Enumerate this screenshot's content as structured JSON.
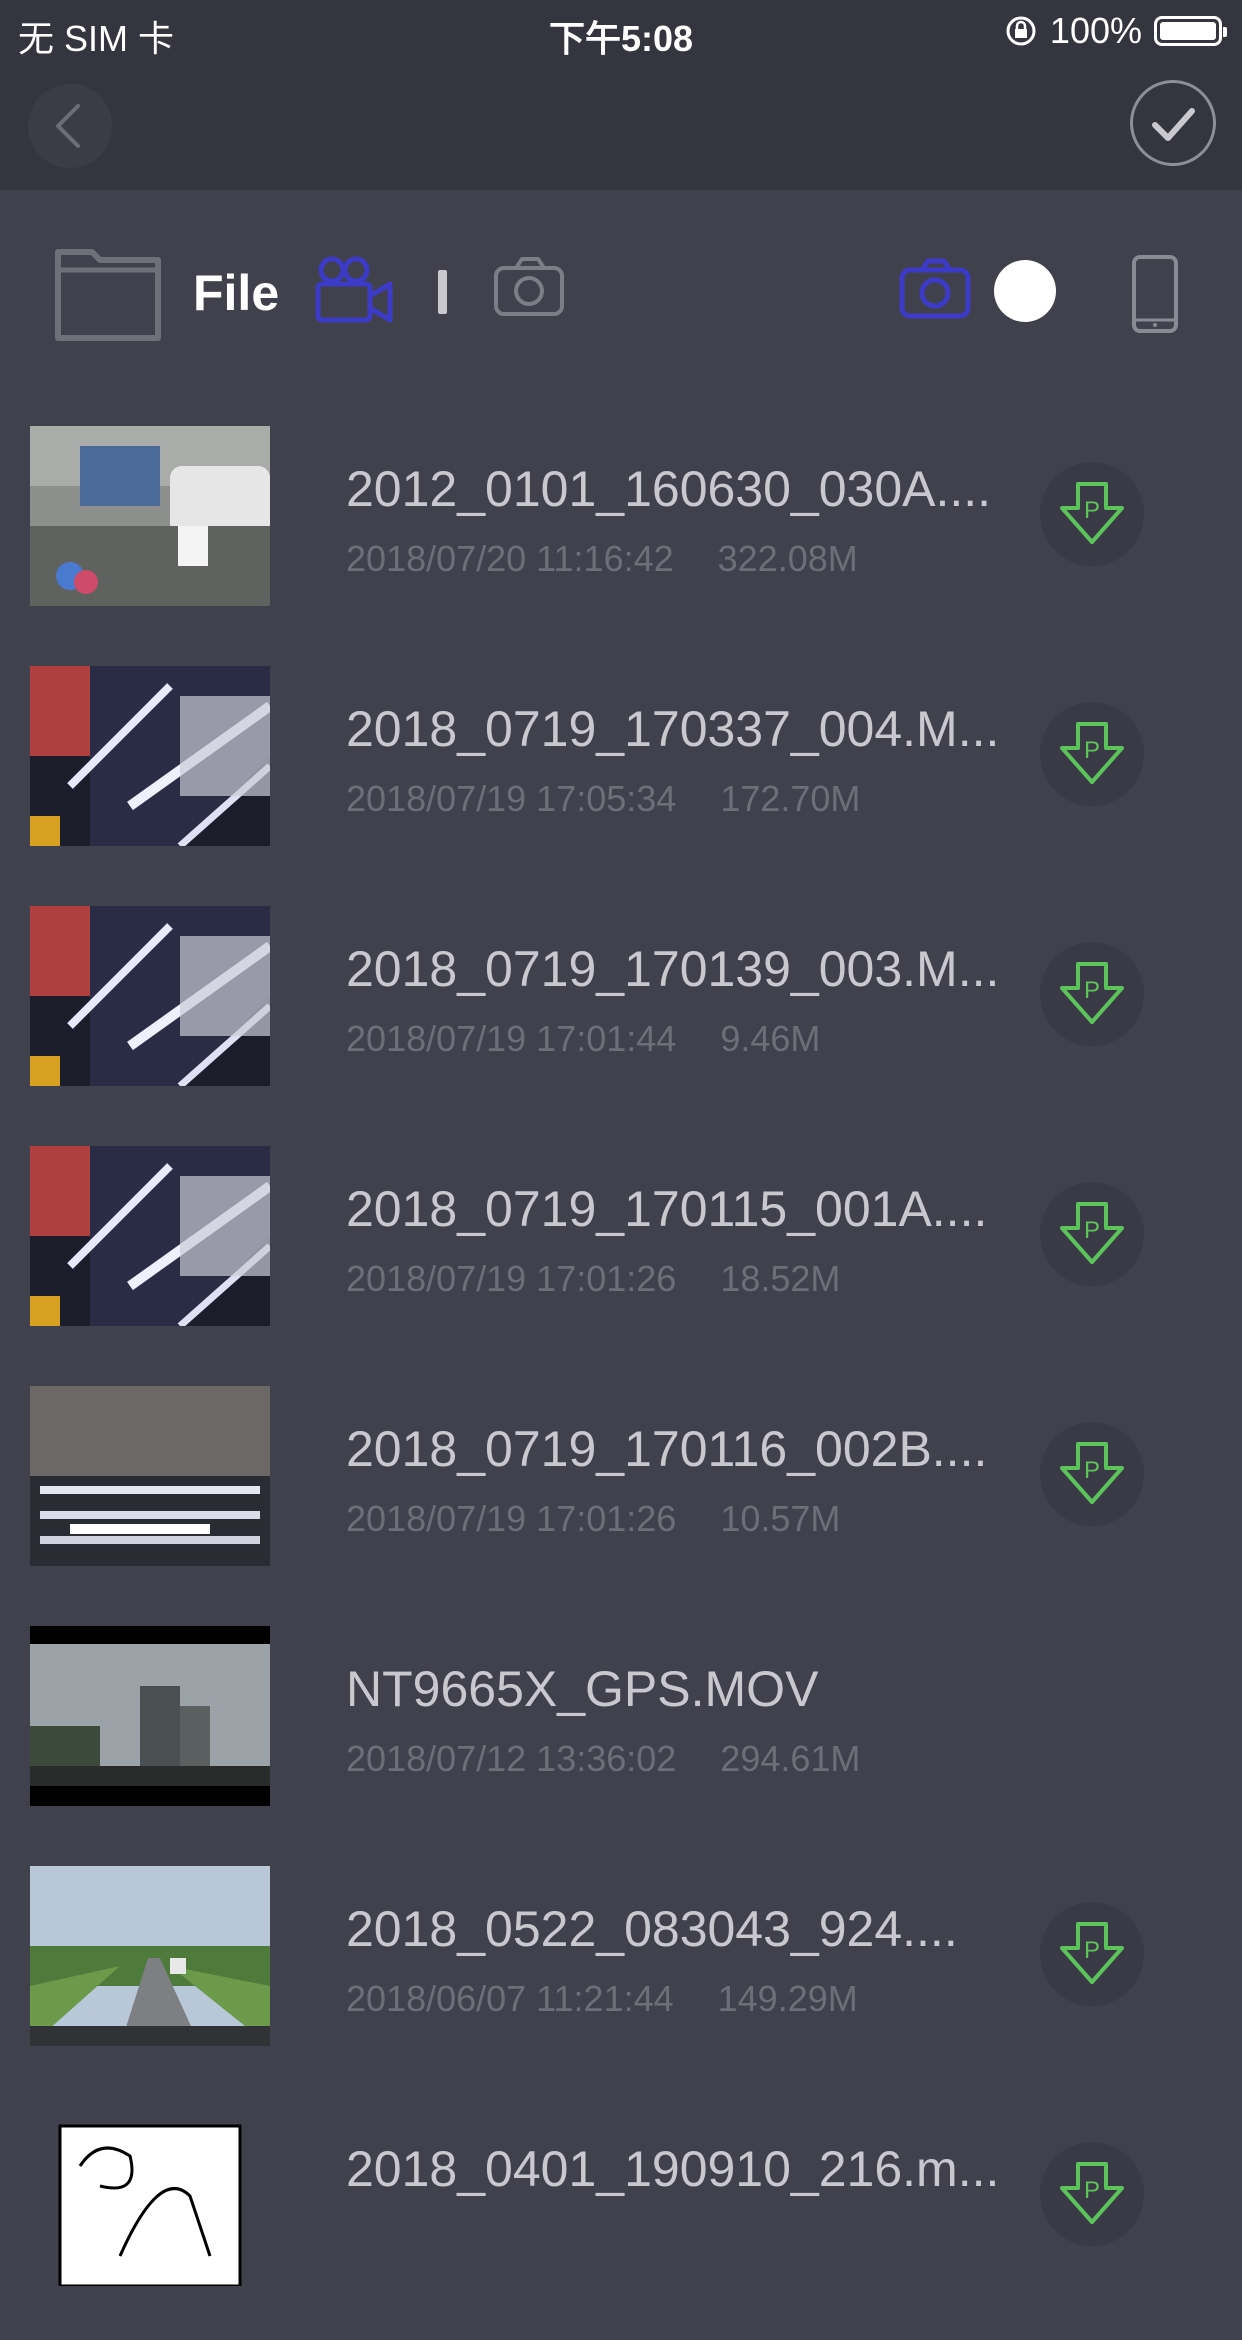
{
  "status_bar": {
    "carrier": "无 SIM 卡",
    "time": "下午5:08",
    "battery": "100%"
  },
  "toolbar": {
    "file_label": "File"
  },
  "colors": {
    "accent": "#3b3bc8",
    "download": "#5cc45a",
    "background": "#41414e",
    "header": "#35353f"
  },
  "files": [
    {
      "name": "2012_0101_160630_030A....",
      "date": "2018/07/20 11:16:42",
      "size": "322.08M",
      "downloadable": true,
      "thumb": "street"
    },
    {
      "name": "2018_0719_170337_004.M...",
      "date": "2018/07/19 17:05:34",
      "size": "172.70M",
      "downloadable": true,
      "thumb": "garage"
    },
    {
      "name": "2018_0719_170139_003.M...",
      "date": "2018/07/19 17:01:44",
      "size": "9.46M",
      "downloadable": true,
      "thumb": "garage"
    },
    {
      "name": "2018_0719_170115_001A....",
      "date": "2018/07/19 17:01:26",
      "size": "18.52M",
      "downloadable": true,
      "thumb": "garage"
    },
    {
      "name": "2018_0719_170116_002B....",
      "date": "2018/07/19 17:01:26",
      "size": "10.57M",
      "downloadable": true,
      "thumb": "ceiling"
    },
    {
      "name": "NT9665X_GPS.MOV",
      "date": "2018/07/12 13:36:02",
      "size": "294.61M",
      "downloadable": false,
      "thumb": "city"
    },
    {
      "name": "2018_0522_083043_924....",
      "date": "2018/06/07 11:21:44",
      "size": "149.29M",
      "downloadable": true,
      "thumb": "road"
    },
    {
      "name": "2018_0401_190910_216.m...",
      "date": "",
      "size": "",
      "downloadable": true,
      "thumb": "sketch"
    }
  ]
}
